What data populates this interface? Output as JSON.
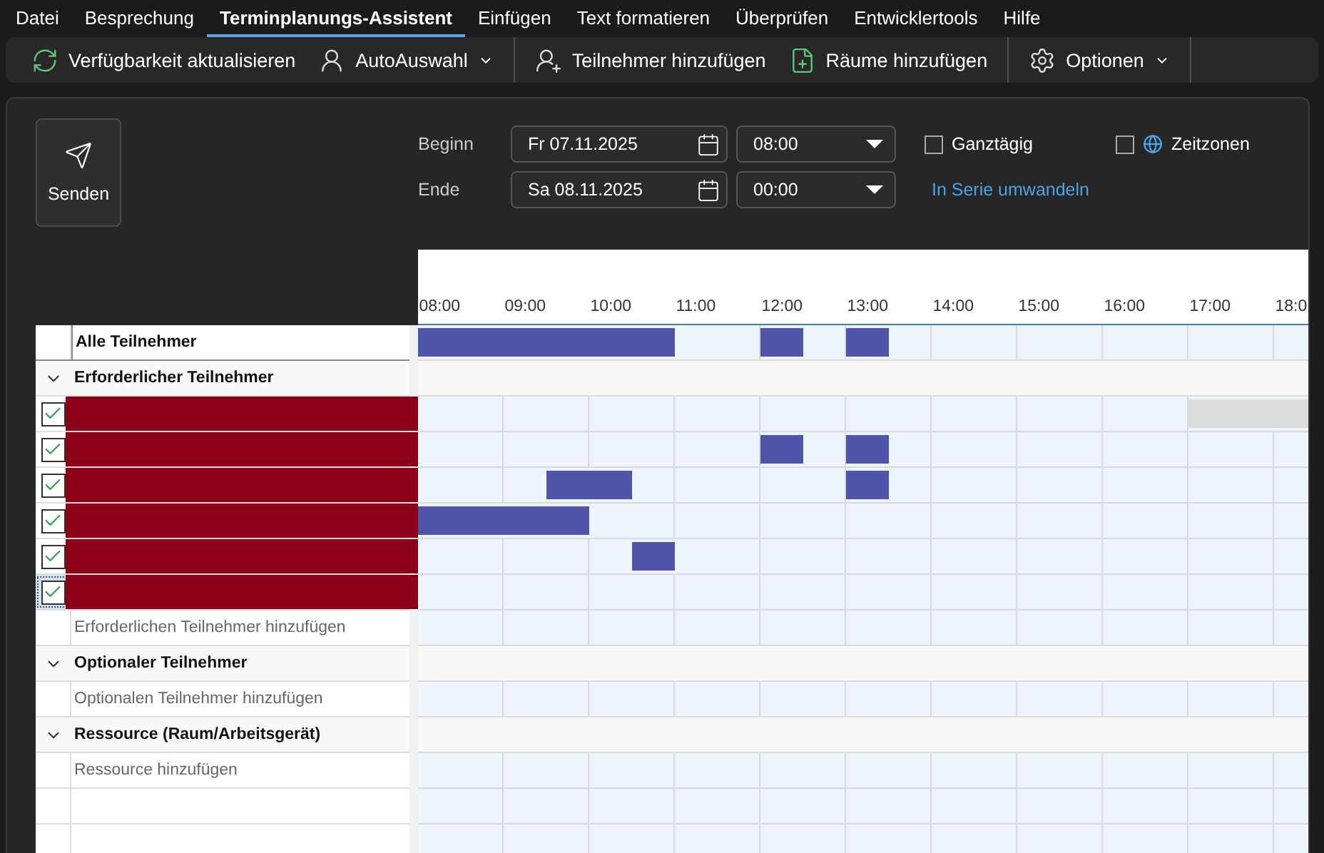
{
  "menu": {
    "tabs": [
      {
        "label": "Datei",
        "selected": false
      },
      {
        "label": "Besprechung",
        "selected": false
      },
      {
        "label": "Terminplanungs-Assistent",
        "selected": true
      },
      {
        "label": "Einfügen",
        "selected": false
      },
      {
        "label": "Text formatieren",
        "selected": false
      },
      {
        "label": "Überprüfen",
        "selected": false
      },
      {
        "label": "Entwicklertools",
        "selected": false
      },
      {
        "label": "Hilfe",
        "selected": false
      }
    ]
  },
  "toolbar": {
    "items": [
      {
        "kind": "button",
        "label": "Verfügbarkeit aktualisieren"
      },
      {
        "kind": "dropdown",
        "label": "AutoAuswahl"
      },
      {
        "kind": "button",
        "label": "Teilnehmer hinzufügen"
      },
      {
        "kind": "button",
        "label": "Räume hinzufügen"
      },
      {
        "kind": "dropdown",
        "label": "Optionen"
      }
    ]
  },
  "form": {
    "send_label": "Senden",
    "start": {
      "label": "Beginn",
      "date": "Fr 07.11.2025",
      "time": "08:00"
    },
    "end": {
      "label": "Ende",
      "date": "Sa 08.11.2025",
      "time": "00:00"
    },
    "all_day": {
      "label": "Ganztägig",
      "checked": false
    },
    "time_zones": {
      "label": "Zeitzonen",
      "checked": false
    },
    "recurrence_link": "In Serie umwandeln"
  },
  "schedule": {
    "hours": [
      "08:00",
      "09:00",
      "10:00",
      "11:00",
      "12:00",
      "13:00",
      "14:00",
      "15:00",
      "16:00",
      "17:00",
      "18:0"
    ],
    "all_row": {
      "label": "Alle Teilnehmer",
      "busy": [
        true,
        true,
        true,
        true,
        true,
        true,
        false,
        false,
        true,
        false,
        true,
        false,
        false,
        false,
        false,
        false,
        false,
        false,
        false,
        false,
        false
      ]
    },
    "groups": [
      {
        "label": "Erforderlicher Teilnehmer",
        "expanded": true,
        "add_label": "Erforderlichen Teilnehmer hinzufügen",
        "attendees": [
          {
            "checked": true,
            "selected": false,
            "redacted": true,
            "busy": [
              false,
              false,
              false,
              false,
              false,
              false,
              false,
              false,
              false,
              false,
              false,
              false,
              false,
              false,
              false,
              false,
              false,
              false,
              false,
              false,
              false
            ],
            "unavailable": [
              false,
              false,
              false,
              false,
              false,
              false,
              false,
              false,
              false,
              false,
              false,
              false,
              false,
              false,
              false,
              false,
              false,
              false,
              true,
              true,
              true
            ]
          },
          {
            "checked": true,
            "selected": false,
            "redacted": true,
            "busy": [
              false,
              false,
              false,
              false,
              false,
              false,
              false,
              false,
              true,
              false,
              true,
              false,
              false,
              false,
              false,
              false,
              false,
              false,
              false,
              false,
              false
            ]
          },
          {
            "checked": true,
            "selected": false,
            "redacted": true,
            "busy": [
              false,
              false,
              false,
              true,
              true,
              false,
              false,
              false,
              false,
              false,
              true,
              false,
              false,
              false,
              false,
              false,
              false,
              false,
              false,
              false,
              false
            ]
          },
          {
            "checked": true,
            "selected": false,
            "redacted": true,
            "busy": [
              true,
              true,
              true,
              true,
              false,
              false,
              false,
              false,
              false,
              false,
              false,
              false,
              false,
              false,
              false,
              false,
              false,
              false,
              false,
              false,
              false
            ]
          },
          {
            "checked": true,
            "selected": false,
            "redacted": true,
            "busy": [
              false,
              false,
              false,
              false,
              false,
              true,
              false,
              false,
              false,
              false,
              false,
              false,
              false,
              false,
              false,
              false,
              false,
              false,
              false,
              false,
              false
            ]
          },
          {
            "checked": true,
            "selected": true,
            "redacted": true,
            "busy": [
              false,
              false,
              false,
              false,
              false,
              false,
              false,
              false,
              false,
              false,
              false,
              false,
              false,
              false,
              false,
              false,
              false,
              false,
              false,
              false,
              false
            ]
          }
        ]
      },
      {
        "label": "Optionaler Teilnehmer",
        "expanded": true,
        "add_label": "Optionalen Teilnehmer hinzufügen"
      },
      {
        "label": "Ressource (Raum/Arbeitsgerät)",
        "expanded": true,
        "add_label": "Ressource hinzufügen"
      }
    ]
  }
}
